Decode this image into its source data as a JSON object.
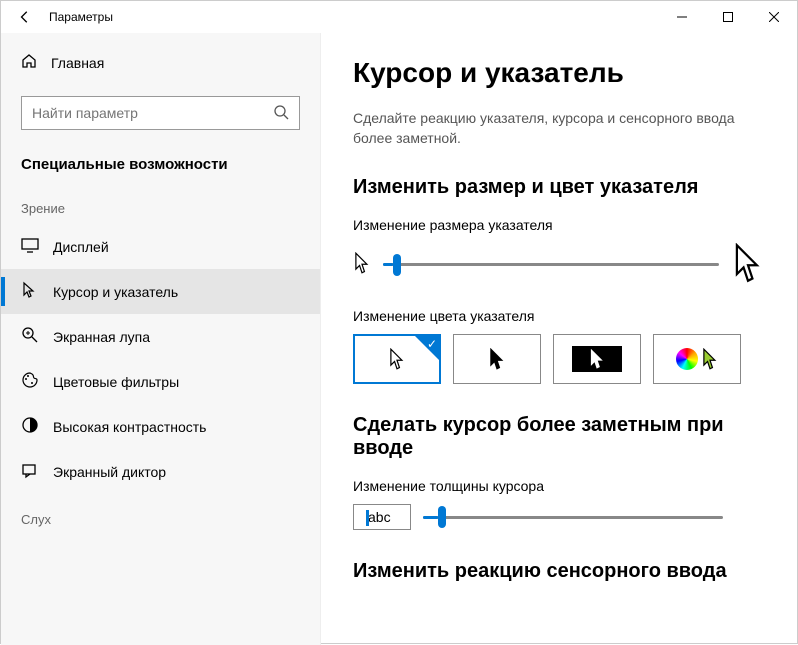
{
  "window": {
    "title": "Параметры"
  },
  "sidebar": {
    "home": "Главная",
    "search_placeholder": "Найти параметр",
    "category": "Специальные возможности",
    "groups": [
      {
        "title": "Зрение",
        "items": [
          {
            "id": "display",
            "label": "Дисплей",
            "selected": false
          },
          {
            "id": "cursor",
            "label": "Курсор и указатель",
            "selected": true
          },
          {
            "id": "magnifier",
            "label": "Экранная лупа",
            "selected": false
          },
          {
            "id": "color-filters",
            "label": "Цветовые фильтры",
            "selected": false
          },
          {
            "id": "high-contrast",
            "label": "Высокая контрастность",
            "selected": false
          },
          {
            "id": "narrator",
            "label": "Экранный диктор",
            "selected": false
          }
        ]
      },
      {
        "title": "Слух",
        "items": []
      }
    ]
  },
  "main": {
    "title": "Курсор и указатель",
    "description": "Сделайте реакцию указателя, курсора и сенсорного ввода более заметной.",
    "section_pointer": {
      "heading": "Изменить размер и цвет указателя",
      "size_label": "Изменение размера указателя",
      "size_value_pct": 3,
      "color_label": "Изменение цвета указателя",
      "options": [
        "white",
        "black",
        "inverted",
        "custom"
      ],
      "selected_option": "white"
    },
    "section_cursor": {
      "heading": "Сделать курсор более заметным при вводе",
      "thickness_label": "Изменение толщины курсора",
      "preview_text": "abc",
      "thickness_value_pct": 5
    },
    "section_touch": {
      "heading": "Изменить реакцию сенсорного ввода"
    }
  }
}
